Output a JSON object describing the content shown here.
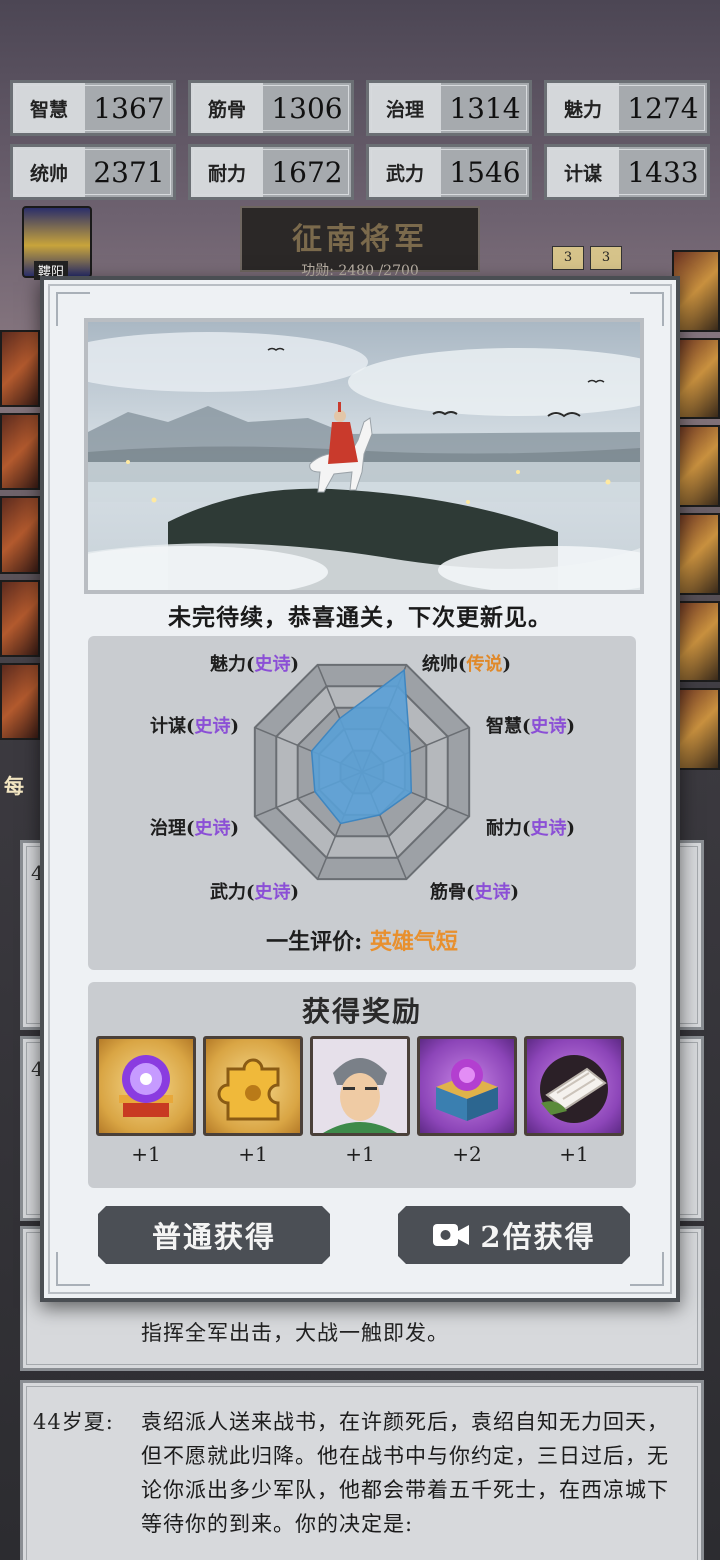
{
  "stats": [
    {
      "label": "智慧",
      "value": "1367"
    },
    {
      "label": "筋骨",
      "value": "1306"
    },
    {
      "label": "治理",
      "value": "1314"
    },
    {
      "label": "魅力",
      "value": "1274"
    },
    {
      "label": "统帅",
      "value": "2371"
    },
    {
      "label": "耐力",
      "value": "1672"
    },
    {
      "label": "武力",
      "value": "1546"
    },
    {
      "label": "计谋",
      "value": "1433"
    }
  ],
  "header": {
    "rank_title": "征南将军",
    "merit": "功勋: 2480 /2700",
    "emblem_label": "鞻阳"
  },
  "background": {
    "badges": [
      "3",
      "3"
    ],
    "left_label": "每",
    "card4": {
      "age": "44岁夏:",
      "text": "袁绍派人送来战书，在许颜死后，袁绍自知无力回天，但不愿就此归降。他在战书中与你约定，三日过后，无论你派出多少军队，他都会带着五千死士，在西凉城下等待你的到来。你的决定是:"
    },
    "card3_text": "指挥全军出击，大战一触即发。",
    "card_age_fragment": "4"
  },
  "modal": {
    "ending_text": "未完待续，恭喜通关，下次更新见。",
    "attributes": [
      {
        "name": "魅力",
        "tier": "史诗",
        "legend": false
      },
      {
        "name": "统帅",
        "tier": "传说",
        "legend": true
      },
      {
        "name": "智慧",
        "tier": "史诗",
        "legend": false
      },
      {
        "name": "耐力",
        "tier": "史诗",
        "legend": false
      },
      {
        "name": "筋骨",
        "tier": "史诗",
        "legend": false
      },
      {
        "name": "武力",
        "tier": "史诗",
        "legend": false
      },
      {
        "name": "治理",
        "tier": "史诗",
        "legend": false
      },
      {
        "name": "计谋",
        "tier": "史诗",
        "legend": false
      }
    ],
    "radar_levels": [
      0.5,
      0.95,
      0.45,
      0.46,
      0.4,
      0.48,
      0.44,
      0.47
    ],
    "life_eval_label": "一生评价:",
    "life_eval_value": "英雄气短",
    "reward_title": "获得奖励",
    "rewards": [
      {
        "icon": "purple-orb-icon",
        "count": "+1"
      },
      {
        "icon": "puzzle-piece-icon",
        "count": "+1"
      },
      {
        "icon": "general-portrait-icon",
        "count": "+1"
      },
      {
        "icon": "treasure-chest-icon",
        "count": "+2"
      },
      {
        "icon": "silk-cloth-icon",
        "count": "+1"
      }
    ],
    "btn_normal": "普通获得",
    "btn_double": "2倍获得"
  },
  "colors": {
    "epic_tier": "#8b4fd6",
    "legend_tier": "#e0892a",
    "radar_fill": "#5aa0d6",
    "button_bg": "#4b4f55"
  }
}
